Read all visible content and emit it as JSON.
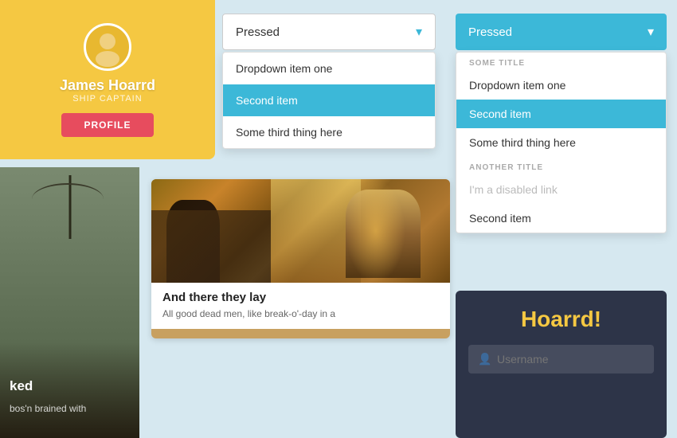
{
  "profile": {
    "name": "James Hoarrd",
    "title": "SHIP CAPTAIN",
    "button_label": "PROFILE"
  },
  "dropdown_simple": {
    "selected": "Pressed",
    "items": [
      {
        "label": "Dropdown item one",
        "active": false
      },
      {
        "label": "Second item",
        "active": true
      },
      {
        "label": "Some third thing here",
        "active": false
      }
    ]
  },
  "dropdown_grouped": {
    "selected": "Pressed",
    "groups": [
      {
        "title": "SOME TITLE",
        "items": [
          {
            "label": "Dropdown item one",
            "active": false,
            "disabled": false
          },
          {
            "label": "Second item",
            "active": true,
            "disabled": false
          },
          {
            "label": "Some third thing here",
            "active": false,
            "disabled": false
          }
        ]
      },
      {
        "title": "ANOTHER TITLE",
        "items": [
          {
            "label": "I'm a disabled link",
            "active": false,
            "disabled": true
          },
          {
            "label": "Second item",
            "active": false,
            "disabled": false
          }
        ]
      }
    ]
  },
  "image_card": {
    "title": "And there they lay",
    "body": "All good dead men, like break-o'-day in a"
  },
  "hoarrd": {
    "title": "Hoarrd!",
    "username_placeholder": "Username"
  },
  "left_overlay": {
    "line1": "ked",
    "line2": "bos'n brained with"
  }
}
